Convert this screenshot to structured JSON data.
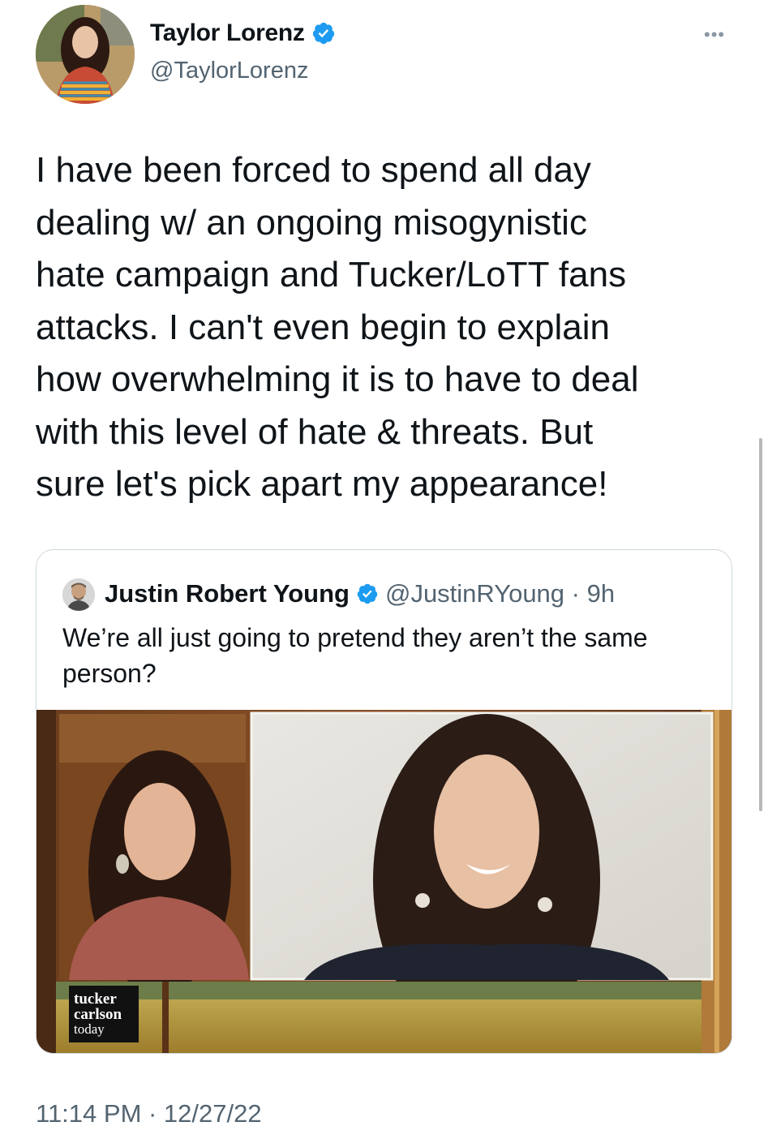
{
  "author": {
    "display_name": "Taylor Lorenz",
    "handle": "@TaylorLorenz",
    "verified": true,
    "avatar_icon": "profile-photo"
  },
  "tweet": {
    "text": "I have been forced to spend all day\ndealing w/ an ongoing misogynistic\nhate campaign and Tucker/LoTT fans\nattacks. I can't even begin to explain\nhow overwhelming it is to have to deal\nwith this level of hate & threats. But\nsure let's pick apart my appearance!",
    "timestamp": "11:14 PM · 12/27/22"
  },
  "quoted_tweet": {
    "display_name": "Justin Robert Young",
    "handle_time": "@JustinRYoung · 9h",
    "verified": true,
    "text": "We’re all just going to pretend they aren’t the same person?",
    "media": {
      "logo_text": "tucker carlson today"
    }
  },
  "colors": {
    "text": "#0f1419",
    "secondary": "#536471",
    "verified": "#1d9bf0",
    "border": "#cfd9de"
  },
  "icons": {
    "more": "more-horizontal-icon",
    "verified": "verified-badge-icon"
  }
}
